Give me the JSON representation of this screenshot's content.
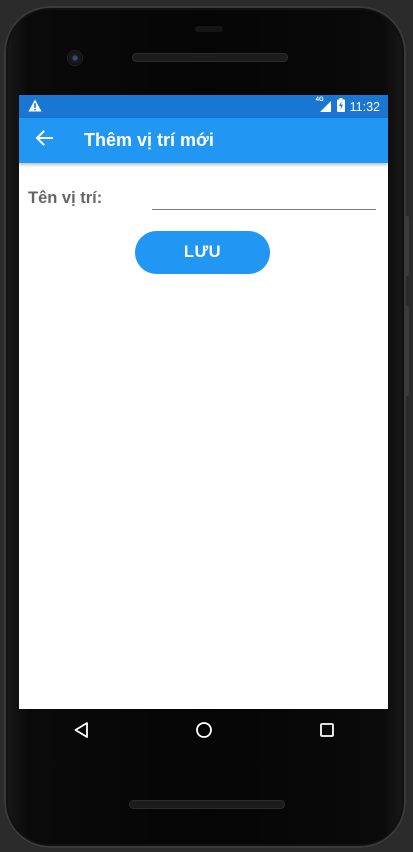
{
  "status_bar": {
    "alert_icon": "warning-icon",
    "network_label": "4G",
    "battery_icon": "battery-charging-icon",
    "time": "11:32"
  },
  "app_bar": {
    "back_icon": "arrow-left-icon",
    "title": "Thêm vị trí mới"
  },
  "form": {
    "name_label": "Tên vị trí:",
    "name_value": "",
    "name_placeholder": ""
  },
  "actions": {
    "save_label": "LƯU"
  },
  "nav_bar": {
    "back_icon": "triangle-back-icon",
    "home_icon": "circle-home-icon",
    "recents_icon": "square-recents-icon"
  },
  "colors": {
    "status_bar": "#1976d2",
    "app_bar": "#2196f3",
    "button": "#2196f3",
    "label_text": "#666666"
  }
}
